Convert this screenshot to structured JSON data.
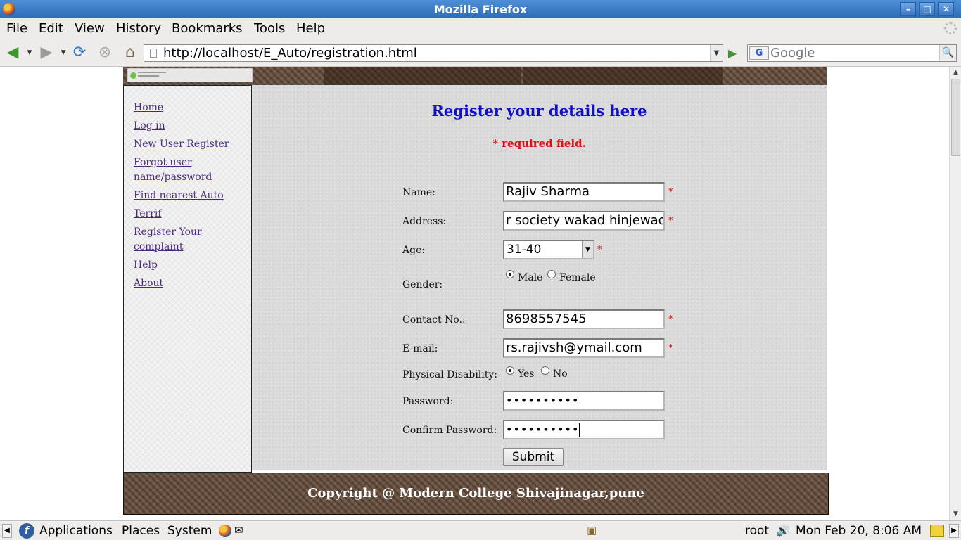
{
  "window": {
    "title": "Mozilla Firefox"
  },
  "menu": [
    "File",
    "Edit",
    "View",
    "History",
    "Bookmarks",
    "Tools",
    "Help"
  ],
  "toolbar": {
    "url": "http://localhost/E_Auto/registration.html",
    "search_placeholder": "Google"
  },
  "sidebar": {
    "links": [
      "Home",
      "Log in",
      "New User Register",
      "Forgot user name/password",
      "Find nearest Auto",
      "Terrif",
      "Register Your complaint",
      "Help",
      "About"
    ]
  },
  "form": {
    "heading": "Register your details here",
    "required_note": "* required field.",
    "star": "*",
    "labels": {
      "name": "Name:",
      "address": "Address:",
      "age": "Age:",
      "gender": "Gender:",
      "contact": "Contact No.:",
      "email": "E-mail:",
      "disability": "Physical Disability:",
      "password": "Password:",
      "confirm": "Confirm Password:"
    },
    "values": {
      "name": "Rajiv Sharma",
      "address": "r society wakad hinjewadi",
      "age": "31-40",
      "contact": "8698557545",
      "email": "rs.rajivsh@ymail.com",
      "password_mask": "••••••••••",
      "confirm_mask": "••••••••••"
    },
    "gender_options": [
      "Male",
      "Female"
    ],
    "gender_selected": "Male",
    "disability_options": [
      "Yes",
      "No"
    ],
    "disability_selected": "Yes",
    "submit": "Submit"
  },
  "footer": {
    "text": "Copyright @ Modern College Shivajinagar,pune"
  },
  "panel": {
    "applications": "Applications",
    "places": "Places",
    "system": "System",
    "user": "root",
    "clock": "Mon Feb 20,  8:06 AM"
  },
  "colors": {
    "heading": "#1010c8",
    "required": "#e01010",
    "titlebar": "#3a7bc8"
  }
}
